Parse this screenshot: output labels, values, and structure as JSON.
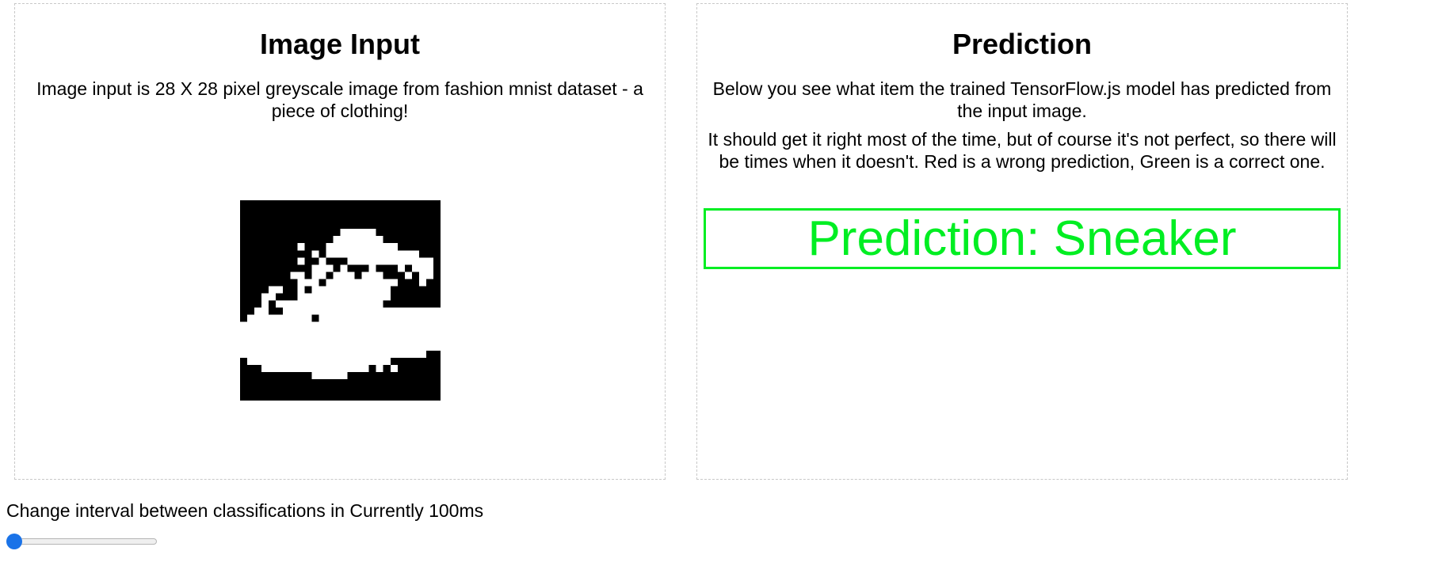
{
  "input_panel": {
    "heading": "Image Input",
    "description": "Image input is 28 X 28 pixel greyscale image from fashion mnist dataset - a piece of clothing!",
    "image_alt": "sneaker"
  },
  "prediction_panel": {
    "heading": "Prediction",
    "description_1": "Below you see what item the trained TensorFlow.js model has predicted from the input image.",
    "description_2": "It should get it right most of the time, but of course it's not perfect, so there will be times when it doesn't. Red is a wrong prediction, Green is a correct one.",
    "prediction_text": "Prediction: Sneaker",
    "prediction_status": "correct",
    "status_color": "#00ee22"
  },
  "controls": {
    "interval_label": "Change interval between classifications in Currently 100ms",
    "slider_fraction": 0.0,
    "slider_accent_color": "#1a73e8"
  }
}
